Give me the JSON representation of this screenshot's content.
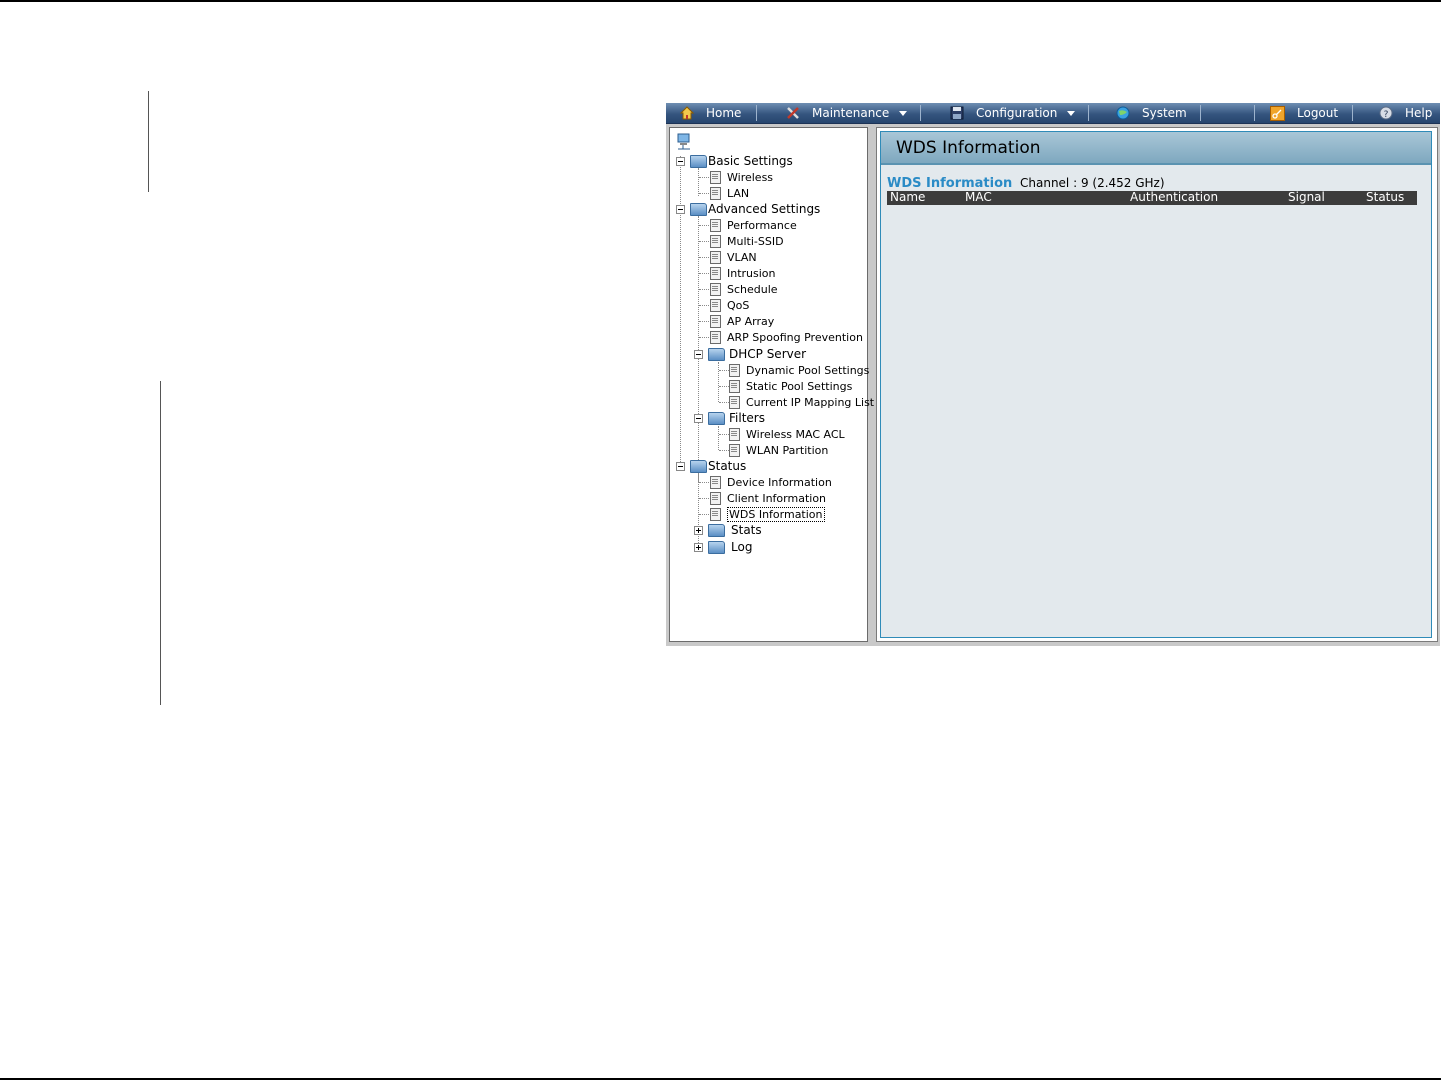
{
  "menubar": {
    "items": [
      {
        "label": "Home",
        "icon": "home-icon"
      },
      {
        "label": "Maintenance",
        "icon": "tools-icon"
      },
      {
        "label": "Configuration",
        "icon": "floppy-disk-icon"
      },
      {
        "label": "System",
        "icon": "globe-icon"
      },
      {
        "label": "Logout",
        "icon": "key-icon"
      },
      {
        "label": "Help",
        "icon": "help-icon"
      }
    ]
  },
  "tree": {
    "root_icon": "network-computer-icon",
    "basic_settings": {
      "label": "Basic Settings",
      "children": [
        "Wireless",
        "LAN"
      ]
    },
    "advanced_settings": {
      "label": "Advanced Settings",
      "children": [
        "Performance",
        "Multi-SSID",
        "VLAN",
        "Intrusion",
        "Schedule",
        "QoS",
        "AP Array",
        "ARP Spoofing Prevention"
      ],
      "dhcp_server": {
        "label": "DHCP Server",
        "children": [
          "Dynamic Pool Settings",
          "Static Pool Settings",
          "Current IP Mapping List"
        ]
      },
      "filters": {
        "label": "Filters",
        "children": [
          "Wireless MAC ACL",
          "WLAN Partition"
        ]
      }
    },
    "status": {
      "label": "Status",
      "children": [
        "Device Information",
        "Client Information",
        "WDS Information"
      ],
      "stats": {
        "label": "Stats"
      },
      "log": {
        "label": "Log"
      }
    }
  },
  "content": {
    "panel_title": "WDS Information",
    "sub_title": "WDS Information",
    "channel": "Channel : 9 (2.452 GHz)",
    "columns": [
      "Name",
      "MAC",
      "Authentication",
      "Signal",
      "Status"
    ]
  },
  "colors": {
    "menubar": "#35557f",
    "panel_background": "#e3e9ed",
    "panel_border": "#2f8bb8",
    "sub_title": "#2a8bc6",
    "table_header": "#3c3c3c"
  }
}
